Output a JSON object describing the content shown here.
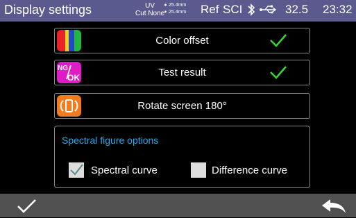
{
  "status": {
    "title": "Display settings",
    "light_source_top": "UV",
    "light_source_bottom": "Cut None",
    "aperture_top": "25.4mm",
    "aperture_bottom": "25.4mm",
    "ref": "Ref",
    "sci": "SCI",
    "bluetooth_icon": "bluetooth-icon",
    "usb_icon": "usb-icon",
    "temperature": "32.5",
    "time": "23:32"
  },
  "rows": [
    {
      "label": "Color offset",
      "icon": "color-offset-icon",
      "checked": true
    },
    {
      "label": "Test result",
      "icon": "ng-ok-icon",
      "icon_text_top": "NG",
      "icon_text_bottom": "OK",
      "checked": true
    },
    {
      "label": "Rotate screen 180°",
      "icon": "rotate-screen-icon",
      "checked": false
    }
  ],
  "spectral": {
    "header": "Spectral figure options",
    "spectral_curve": {
      "label": "Spectral curve",
      "checked": true
    },
    "difference_curve": {
      "label": "Difference curve",
      "checked": false
    }
  },
  "colors": {
    "status_bar": "#5b5a8e",
    "bottom_bar": "#505050",
    "check_green": "#34d635",
    "header_blue": "#29a9e8",
    "ng_ok_magenta": "#e01cc6",
    "rotate_orange": "#f37a1f"
  }
}
